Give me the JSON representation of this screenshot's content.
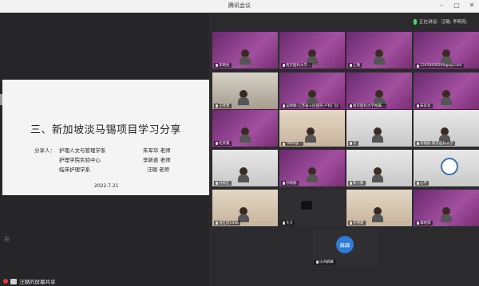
{
  "app": {
    "title": "腾讯会议"
  },
  "speaking": {
    "label": "正在讲话：汪璐; 李明亮;"
  },
  "slide": {
    "heading": "三、新加坡淡马锡项目学习分享",
    "sharer_label": "分享人：",
    "rows": [
      {
        "dept": "护理人文与管理学系",
        "name": "朱军华 老师"
      },
      {
        "dept": "护理学院实验中心",
        "name": "李新香 老师"
      },
      {
        "dept": "临床护理学系",
        "name": "汪璐 老师"
      }
    ],
    "date": "2022.7.21"
  },
  "share_status": "汪璐的屏幕共享",
  "participants": [
    {
      "name": "李明亮",
      "style": "pink"
    },
    {
      "name": "南京医科大学...",
      "style": "pink"
    },
    {
      "name": "江璐",
      "style": "pink"
    },
    {
      "name": "13458939269@qq.com",
      "style": "pink"
    },
    {
      "name": "王晓慧",
      "style": "room"
    },
    {
      "name": "吴晓娟-江苏省人民医院-产科门诊",
      "style": "pink"
    },
    {
      "name": "南京医科大学附属...",
      "style": "pink"
    },
    {
      "name": "朱军华",
      "style": "pink"
    },
    {
      "name": "毛英霞",
      "style": "pink"
    },
    {
      "name": "7002@...",
      "style": "beige"
    },
    {
      "name": "冯",
      "style": "light"
    },
    {
      "name": "刘丽丽·南京医科大学",
      "style": "light"
    },
    {
      "name": "孙姣红",
      "style": "light"
    },
    {
      "name": "孙晓楠",
      "style": "pink"
    },
    {
      "name": "陈小静",
      "style": "light"
    },
    {
      "name": "心平",
      "style": "logo"
    },
    {
      "name": "张红瑶1936",
      "style": "beige"
    },
    {
      "name": "大大",
      "style": "dark"
    },
    {
      "name": "史明霞",
      "style": "beige"
    },
    {
      "name": "蒋晓萍",
      "style": "pink"
    },
    {
      "name": "乐风麻麻",
      "style": "dark",
      "avatar": "麻麻"
    }
  ]
}
